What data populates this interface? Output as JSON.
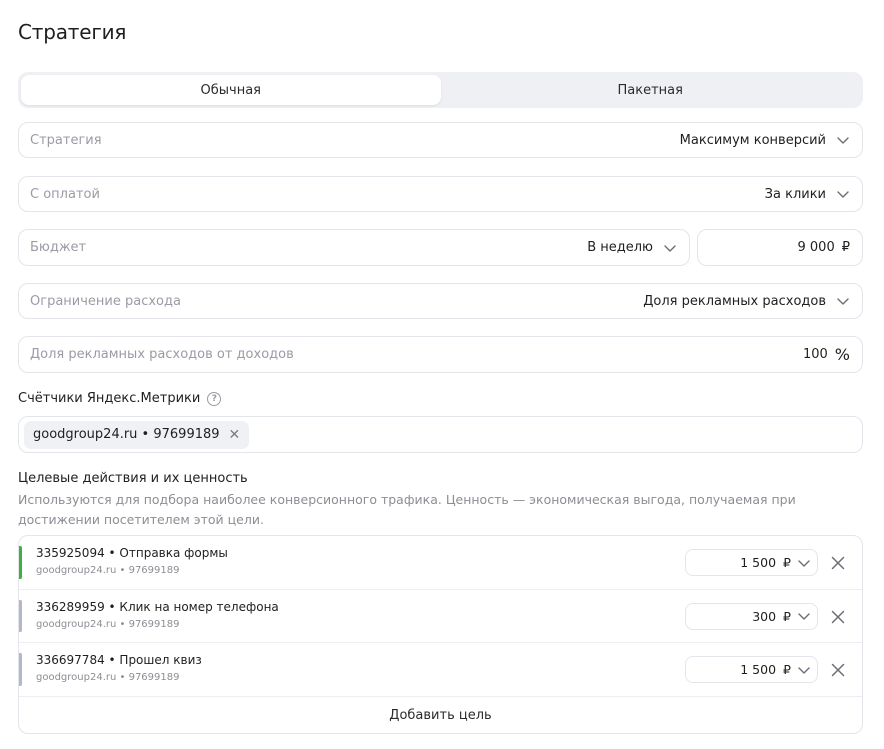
{
  "page_title": "Стратегия",
  "tabs": [
    {
      "label": "Обычная",
      "active": true
    },
    {
      "label": "Пакетная",
      "active": false
    }
  ],
  "fields": {
    "strategy": {
      "label": "Стратегия",
      "value": "Максимум конверсий"
    },
    "payment": {
      "label": "С оплатой",
      "value": "За клики"
    },
    "budget": {
      "label": "Бюджет",
      "value": "В неделю",
      "amount": "9 000",
      "currency": "₽"
    },
    "spend_limit": {
      "label": "Ограничение расхода",
      "value": "Доля рекламных расходов"
    },
    "ad_share": {
      "label": "Доля рекламных расходов от доходов",
      "amount": "100",
      "unit": "%"
    }
  },
  "counters": {
    "label": "Счётчики Яндекс.Метрики",
    "help_icon": "question-circle-icon",
    "chips": [
      {
        "label": "goodgroup24.ru • 97699189"
      }
    ]
  },
  "goals": {
    "title": "Целевые действия и их ценность",
    "description": "Используются для подбора наиболее конверсионного трафика. Ценность — экономическая выгода, получаемая при достижении посетителем этой цели.",
    "items": [
      {
        "name": "335925094 • Отправка формы",
        "source": "goodgroup24.ru • 97699189",
        "value": "1 500",
        "currency": "₽",
        "bar_color": "#3cb043"
      },
      {
        "name": "336289959 • Клик на номер телефона",
        "source": "goodgroup24.ru • 97699189",
        "value": "300",
        "currency": "₽",
        "bar_color": "#b3b8c8"
      },
      {
        "name": "336697784 • Прошел квиз",
        "source": "goodgroup24.ru • 97699189",
        "value": "1 500",
        "currency": "₽",
        "bar_color": "#b3b8c8"
      }
    ],
    "add_label": "Добавить цель"
  },
  "colors": {
    "border": "#e3e5ea",
    "segment_bg": "#eef0f4",
    "muted_text": "#9a9ca3"
  }
}
